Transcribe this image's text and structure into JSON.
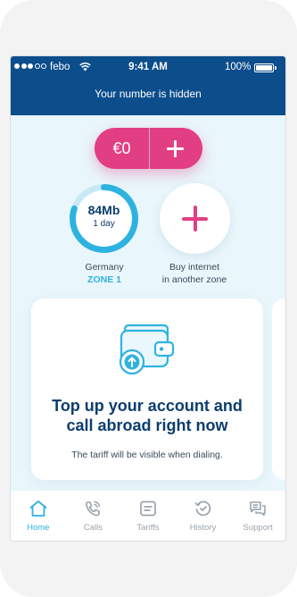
{
  "status_bar": {
    "carrier": "febo",
    "time": "9:41 AM",
    "battery": "100%",
    "signal_bars_filled": 3,
    "signal_bars_total": 5
  },
  "header": {
    "notice": "Your number is hidden"
  },
  "balance": {
    "amount": "€0",
    "add_icon": "plus-icon"
  },
  "data_usage": {
    "value": "84Mb",
    "period": "1 day",
    "remaining_fraction": 0.8,
    "country": "Germany",
    "zone": "ZONE 1"
  },
  "buy_internet": {
    "label_line1": "Buy internet",
    "label_line2": "in another zone",
    "icon": "plus-icon"
  },
  "promo": {
    "icon": "wallet-top-up-icon",
    "title_line1": "Top up your account and",
    "title_line2": "call abroad right now",
    "subtitle": "The tariff will be visible when dialing."
  },
  "tabs": [
    {
      "label": "Home",
      "icon": "home-icon",
      "active": true
    },
    {
      "label": "Calls",
      "icon": "phone-icon",
      "active": false
    },
    {
      "label": "Tariffs",
      "icon": "tariffs-icon",
      "active": false
    },
    {
      "label": "History",
      "icon": "history-icon",
      "active": false
    },
    {
      "label": "Support",
      "icon": "support-chat-icon",
      "active": false
    }
  ],
  "colors": {
    "header_blue": "#0c4d8c",
    "accent_pink": "#e23e83",
    "accent_cyan": "#2eb3e0",
    "screen_background": "#e9f6fb",
    "title_navy": "#0c3d6e",
    "inactive_gray": "#9aa3ad"
  }
}
